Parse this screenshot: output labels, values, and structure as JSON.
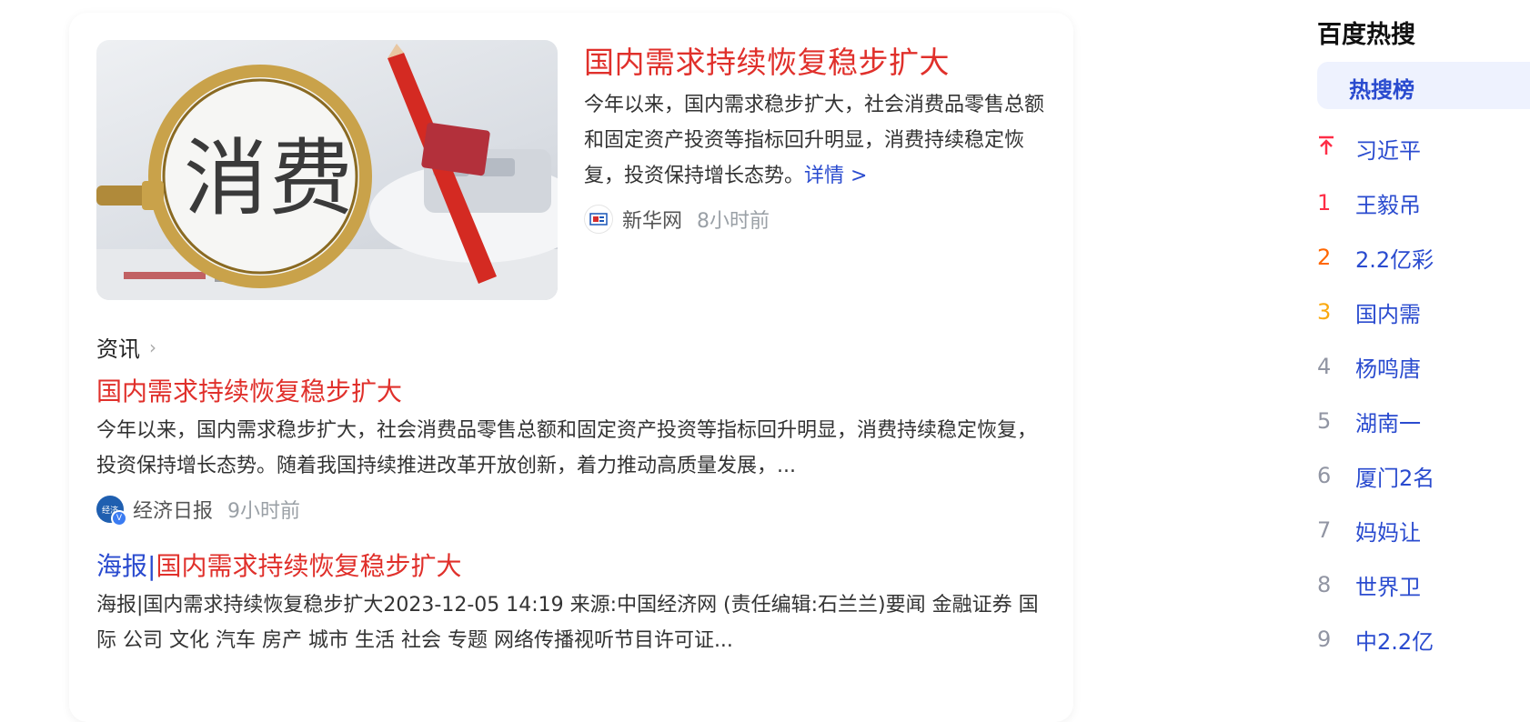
{
  "top_news": {
    "image_text": "消费",
    "title": "国内需求持续恢复稳步扩大",
    "summary": "今年以来，国内需求稳步扩大，社会消费品零售总额和固定资产投资等指标回升明显，消费持续稳定恢复，投资保持增长态势。",
    "more_link": "详情 >",
    "source": "新华网",
    "time": "8小时前"
  },
  "section": {
    "label": "资讯",
    "chevron": "›"
  },
  "news": [
    {
      "title": "国内需求持续恢复稳步扩大",
      "desc": "今年以来，国内需求稳步扩大，社会消费品零售总额和固定资产投资等指标回升明显，消费持续稳定恢复，投资保持增长态势。随着我国持续推进改革开放创新，着力推动高质量发展，...",
      "source": "经济日报",
      "time": "9小时前"
    },
    {
      "title_prefix": "海报|",
      "title": "国内需求持续恢复稳步扩大",
      "desc": "海报|国内需求持续恢复稳步扩大2023-12-05 14:19 来源:中国经济网 (责任编辑:石兰兰)要闻 金融证券 国际 公司 文化 汽车 房产 城市 生活 社会 专题 网络传播视听节目许可证..."
    }
  ],
  "sidebar": {
    "title": "百度热搜",
    "tab": "热搜榜",
    "items": [
      {
        "rank": "↑",
        "text": "习近平"
      },
      {
        "rank": "1",
        "text": "王毅吊"
      },
      {
        "rank": "2",
        "text": "2.2亿彩"
      },
      {
        "rank": "3",
        "text": "国内需"
      },
      {
        "rank": "4",
        "text": "杨鸣唐"
      },
      {
        "rank": "5",
        "text": "湖南一"
      },
      {
        "rank": "6",
        "text": "厦门2名"
      },
      {
        "rank": "7",
        "text": "妈妈让"
      },
      {
        "rank": "8",
        "text": "世界卫"
      },
      {
        "rank": "9",
        "text": "中2.2亿"
      }
    ]
  },
  "colors": {
    "title_red": "#e0302b",
    "link_blue": "#2a4bcf",
    "rank1": "#fe2d46",
    "rank2": "#f60",
    "rank3": "#faa90e"
  }
}
